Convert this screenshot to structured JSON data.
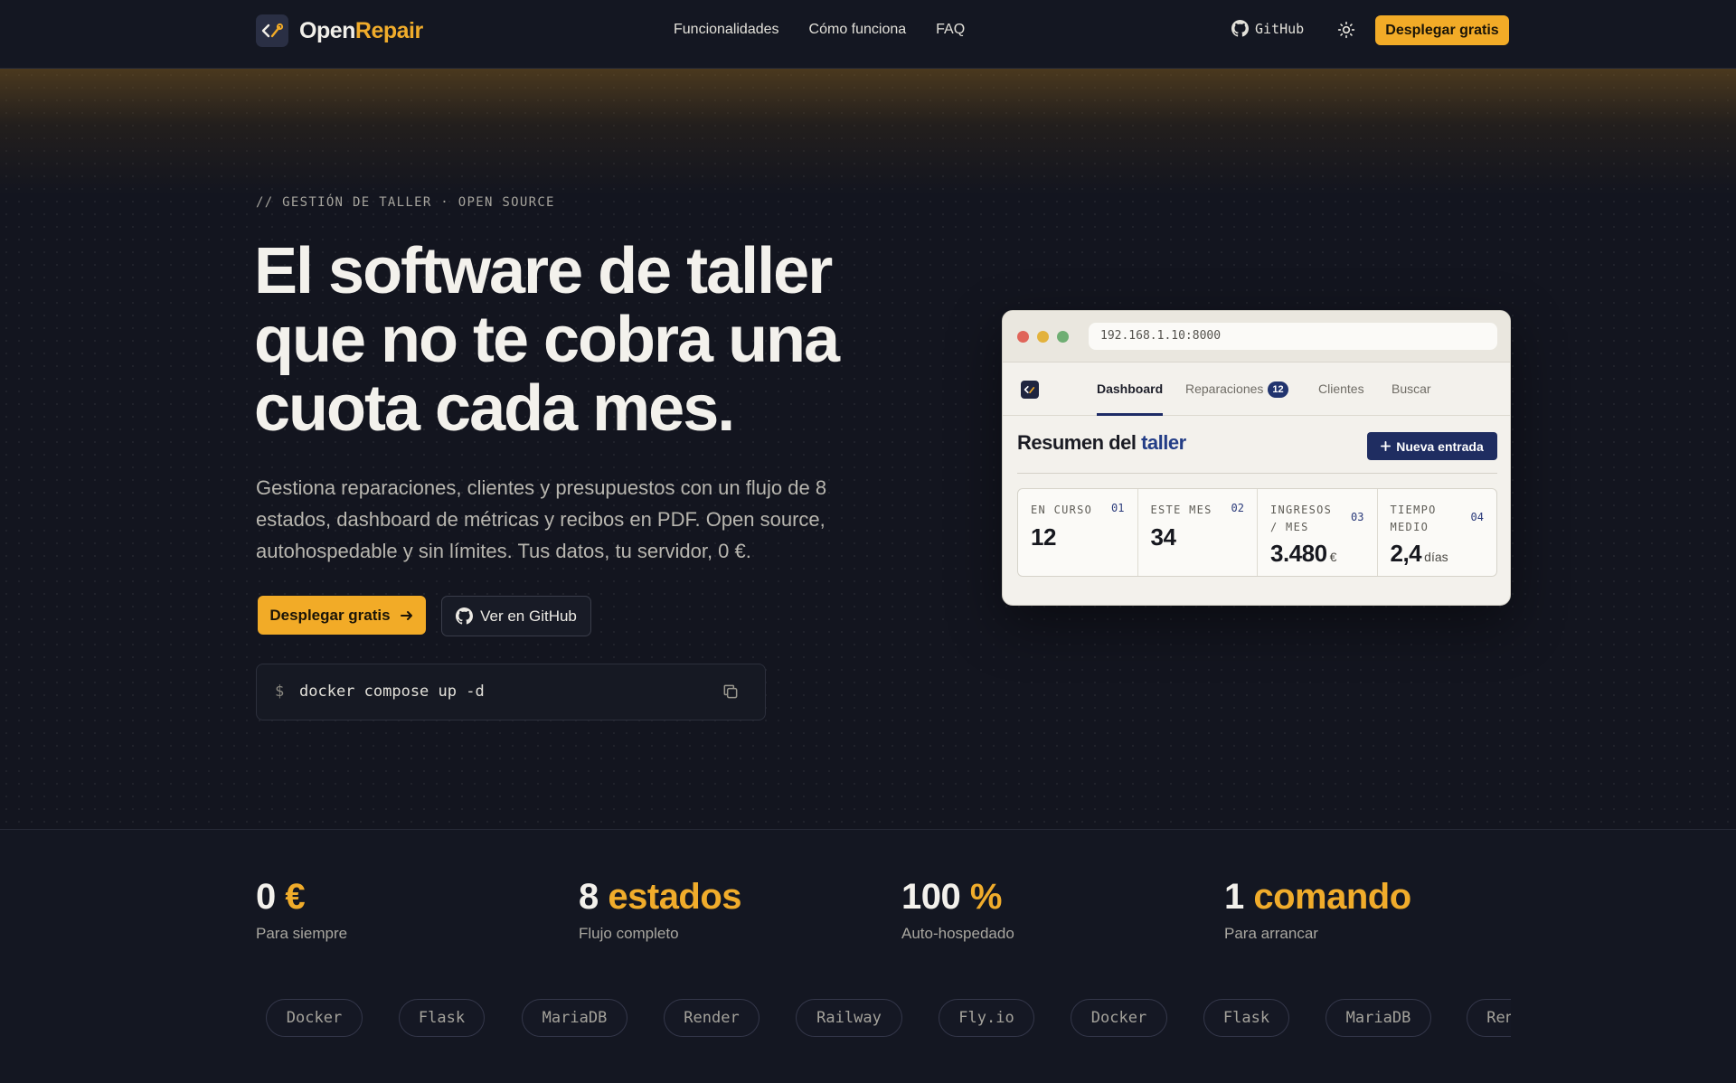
{
  "header": {
    "brand_prefix": "Open",
    "brand_suffix": "Repair",
    "nav": [
      "Funcionalidades",
      "Cómo funciona",
      "FAQ"
    ],
    "github_label": "GitHub",
    "cta_label": "Desplegar gratis"
  },
  "hero": {
    "eyebrow": "// GESTIÓN DE TALLER · OPEN SOURCE",
    "headline_1": "El software de taller",
    "headline_2": "que no te cobra una",
    "headline_3": "cuota cada mes.",
    "subtext": "Gestiona reparaciones, clientes y presupuestos con un flujo de 8 estados, dashboard de métricas y recibos en PDF. Open source, autohospedable y sin límites. Tus datos, tu servidor, 0 €.",
    "primary_cta": "Desplegar gratis",
    "secondary_cta": "Ver en GitHub",
    "code_prompt": "$",
    "code_command": "docker compose up -d"
  },
  "mock": {
    "url": "192.168.1.10:8000",
    "tabs": [
      "Dashboard",
      "Reparaciones",
      "Clientes",
      "Buscar"
    ],
    "repairs_badge": "12",
    "title_prefix": "Resumen del",
    "title_accent": "taller",
    "cta_label": "Nueva entrada",
    "stats": [
      {
        "label": "EN CURSO",
        "num": "01",
        "value": "12",
        "unit": ""
      },
      {
        "label": "ESTE MES",
        "num": "02",
        "value": "34",
        "unit": ""
      },
      {
        "label": "INGRESOS / MES",
        "num": "03",
        "value": "3.480",
        "unit": "€"
      },
      {
        "label": "TIEMPO MEDIO",
        "num": "04",
        "value": "2,4",
        "unit": "días"
      }
    ]
  },
  "metrics": [
    {
      "value": "0",
      "accent": "€",
      "caption": "Para siempre"
    },
    {
      "value": "8",
      "accent": "estados",
      "caption": "Flujo completo"
    },
    {
      "value": "100",
      "accent": "%",
      "caption": "Auto-hospedado"
    },
    {
      "value": "1",
      "accent": "comando",
      "caption": "Para arrancar"
    }
  ],
  "tech": [
    "Docker",
    "Flask",
    "MariaDB",
    "Render",
    "Railway",
    "Fly.io",
    "Docker",
    "Flask",
    "MariaDB",
    "Render"
  ],
  "colors": {
    "accent": "#f2ab27",
    "navy": "#1f2d61",
    "background": "#13151f"
  }
}
